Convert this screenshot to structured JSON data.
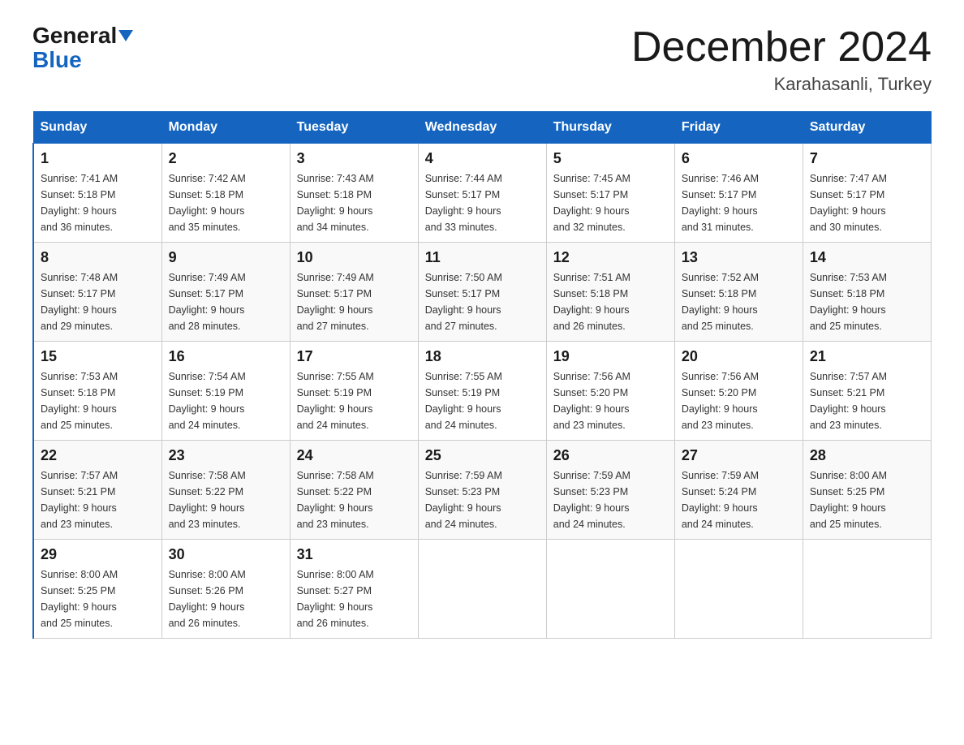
{
  "header": {
    "logo_line1": "General",
    "logo_line2": "Blue",
    "title": "December 2024",
    "subtitle": "Karahasanli, Turkey"
  },
  "days_of_week": [
    "Sunday",
    "Monday",
    "Tuesday",
    "Wednesday",
    "Thursday",
    "Friday",
    "Saturday"
  ],
  "weeks": [
    [
      {
        "day": "1",
        "sunrise": "7:41 AM",
        "sunset": "5:18 PM",
        "daylight": "9 hours and 36 minutes."
      },
      {
        "day": "2",
        "sunrise": "7:42 AM",
        "sunset": "5:18 PM",
        "daylight": "9 hours and 35 minutes."
      },
      {
        "day": "3",
        "sunrise": "7:43 AM",
        "sunset": "5:18 PM",
        "daylight": "9 hours and 34 minutes."
      },
      {
        "day": "4",
        "sunrise": "7:44 AM",
        "sunset": "5:17 PM",
        "daylight": "9 hours and 33 minutes."
      },
      {
        "day": "5",
        "sunrise": "7:45 AM",
        "sunset": "5:17 PM",
        "daylight": "9 hours and 32 minutes."
      },
      {
        "day": "6",
        "sunrise": "7:46 AM",
        "sunset": "5:17 PM",
        "daylight": "9 hours and 31 minutes."
      },
      {
        "day": "7",
        "sunrise": "7:47 AM",
        "sunset": "5:17 PM",
        "daylight": "9 hours and 30 minutes."
      }
    ],
    [
      {
        "day": "8",
        "sunrise": "7:48 AM",
        "sunset": "5:17 PM",
        "daylight": "9 hours and 29 minutes."
      },
      {
        "day": "9",
        "sunrise": "7:49 AM",
        "sunset": "5:17 PM",
        "daylight": "9 hours and 28 minutes."
      },
      {
        "day": "10",
        "sunrise": "7:49 AM",
        "sunset": "5:17 PM",
        "daylight": "9 hours and 27 minutes."
      },
      {
        "day": "11",
        "sunrise": "7:50 AM",
        "sunset": "5:17 PM",
        "daylight": "9 hours and 27 minutes."
      },
      {
        "day": "12",
        "sunrise": "7:51 AM",
        "sunset": "5:18 PM",
        "daylight": "9 hours and 26 minutes."
      },
      {
        "day": "13",
        "sunrise": "7:52 AM",
        "sunset": "5:18 PM",
        "daylight": "9 hours and 25 minutes."
      },
      {
        "day": "14",
        "sunrise": "7:53 AM",
        "sunset": "5:18 PM",
        "daylight": "9 hours and 25 minutes."
      }
    ],
    [
      {
        "day": "15",
        "sunrise": "7:53 AM",
        "sunset": "5:18 PM",
        "daylight": "9 hours and 25 minutes."
      },
      {
        "day": "16",
        "sunrise": "7:54 AM",
        "sunset": "5:19 PM",
        "daylight": "9 hours and 24 minutes."
      },
      {
        "day": "17",
        "sunrise": "7:55 AM",
        "sunset": "5:19 PM",
        "daylight": "9 hours and 24 minutes."
      },
      {
        "day": "18",
        "sunrise": "7:55 AM",
        "sunset": "5:19 PM",
        "daylight": "9 hours and 24 minutes."
      },
      {
        "day": "19",
        "sunrise": "7:56 AM",
        "sunset": "5:20 PM",
        "daylight": "9 hours and 23 minutes."
      },
      {
        "day": "20",
        "sunrise": "7:56 AM",
        "sunset": "5:20 PM",
        "daylight": "9 hours and 23 minutes."
      },
      {
        "day": "21",
        "sunrise": "7:57 AM",
        "sunset": "5:21 PM",
        "daylight": "9 hours and 23 minutes."
      }
    ],
    [
      {
        "day": "22",
        "sunrise": "7:57 AM",
        "sunset": "5:21 PM",
        "daylight": "9 hours and 23 minutes."
      },
      {
        "day": "23",
        "sunrise": "7:58 AM",
        "sunset": "5:22 PM",
        "daylight": "9 hours and 23 minutes."
      },
      {
        "day": "24",
        "sunrise": "7:58 AM",
        "sunset": "5:22 PM",
        "daylight": "9 hours and 23 minutes."
      },
      {
        "day": "25",
        "sunrise": "7:59 AM",
        "sunset": "5:23 PM",
        "daylight": "9 hours and 24 minutes."
      },
      {
        "day": "26",
        "sunrise": "7:59 AM",
        "sunset": "5:23 PM",
        "daylight": "9 hours and 24 minutes."
      },
      {
        "day": "27",
        "sunrise": "7:59 AM",
        "sunset": "5:24 PM",
        "daylight": "9 hours and 24 minutes."
      },
      {
        "day": "28",
        "sunrise": "8:00 AM",
        "sunset": "5:25 PM",
        "daylight": "9 hours and 25 minutes."
      }
    ],
    [
      {
        "day": "29",
        "sunrise": "8:00 AM",
        "sunset": "5:25 PM",
        "daylight": "9 hours and 25 minutes."
      },
      {
        "day": "30",
        "sunrise": "8:00 AM",
        "sunset": "5:26 PM",
        "daylight": "9 hours and 26 minutes."
      },
      {
        "day": "31",
        "sunrise": "8:00 AM",
        "sunset": "5:27 PM",
        "daylight": "9 hours and 26 minutes."
      },
      null,
      null,
      null,
      null
    ]
  ]
}
